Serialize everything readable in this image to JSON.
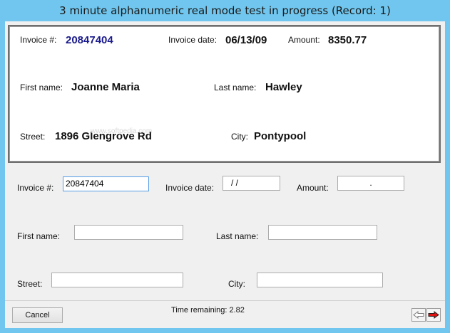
{
  "window": {
    "title": "3 minute alphanumeric real mode test in progress (Record: 1)"
  },
  "record": {
    "invoice_label": "Invoice #:",
    "invoice_value": "20847404",
    "date_label": "Invoice date:",
    "date_value": "06/13/09",
    "amount_label": "Amount:",
    "amount_value": "8350.77",
    "first_label": "First name:",
    "first_value": "Joanne Maria",
    "last_label": "Last name:",
    "last_value": "Hawley",
    "street_label": "Street:",
    "street_value": "1896 Glengrove Rd",
    "city_label": "City:",
    "city_value": "Pontypool",
    "watermark": "www.softpedia.com"
  },
  "entry": {
    "invoice_label": "Invoice #:",
    "invoice_value": "20847404",
    "date_label": "Invoice date:",
    "date_value": "/  /",
    "amount_label": "Amount:",
    "amount_value": ".",
    "first_label": "First name:",
    "first_value": "",
    "last_label": "Last name:",
    "last_value": "",
    "street_label": "Street:",
    "street_value": "",
    "city_label": "City:",
    "city_value": ""
  },
  "footer": {
    "cancel_label": "Cancel",
    "time_label": "Time remaining: 2.82"
  },
  "icons": {
    "prev": "arrow-left-icon",
    "next": "arrow-right-icon",
    "accent_color": "#e01010"
  }
}
